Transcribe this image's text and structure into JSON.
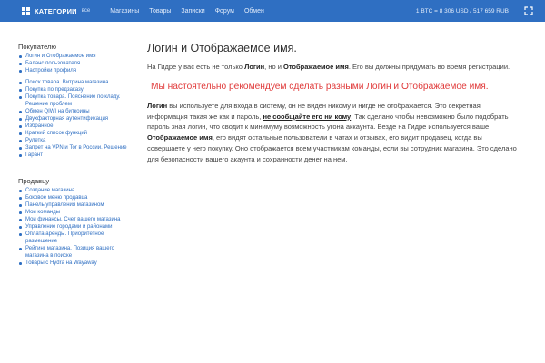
{
  "topbar": {
    "categories_label": "КАТЕГОРИИ",
    "categories_all": "все",
    "nav": [
      "Магазины",
      "Товары",
      "Записки",
      "Форум",
      "Обмен"
    ],
    "rate": "1 BTC = 8 306 USD / 517 659 RUB"
  },
  "sidebar": {
    "buyer_heading": "Покупателю",
    "buyer_items_1": [
      "Логин и Отображаемое имя",
      "Баланс пользователя",
      "Настройки профиля"
    ],
    "buyer_items_2": [
      "Поиск товара. Витрина магазина",
      "Покупка по предзаказу",
      "Покупка товара. Пояснение по кладу. Решение проблем",
      "Обмен QIWI на биткоины",
      "Двухфакторная аутентификация",
      "Избранное",
      "Краткий список функций",
      "Рулетка",
      "Запрет на VPN и Tor в России. Решение",
      "Гарант"
    ],
    "seller_heading": "Продавцу",
    "seller_items": [
      "Создание магазина",
      "Боковое меню продавца",
      "Панель управления магазином",
      "Мои команды",
      "Мои финансы. Счет вашего магазина",
      "Управление городами и районами",
      "Оплата аренды. Приоритетное размещение",
      "Рейтинг магазина. Позиция вашего магазина в поиске",
      "Товары с Hydra на Wayaway"
    ]
  },
  "main": {
    "title": "Логин и Отображаемое имя.",
    "p1": {
      "t1": "На Гидре у вас есть не только ",
      "b1": "Логин",
      "t2": ", но и ",
      "b2": "Отображаемое имя",
      "t3": ". Его вы должны придумать во время регистрации."
    },
    "warning": "Мы настоятельно рекомендуем сделать разными Логин и Отображаемое имя.",
    "p2": {
      "b1": "Логин",
      "t1": " вы используете для входа в систему, он не виден никому и нигде не отображается. Это секретная информация такая же как и пароль, ",
      "u1": "не сообщайте его ни кому",
      "t2": ". Так сделано чтобы невозможно было подобрать пароль зная логин, что сводит к минимуму возможность угона аккаунта. Везде на Гидре используется ваше ",
      "b2": "Отображаемое имя",
      "t3": ", его видят остальные пользователи в чатах и отзывах, его видит продавец, когда вы совершаете у него покупку. Оно отображается всем участникам команды, если вы сотрудник магазина. Это сделано для безопасности вашего акаунта и сохранности денег на нем."
    }
  }
}
